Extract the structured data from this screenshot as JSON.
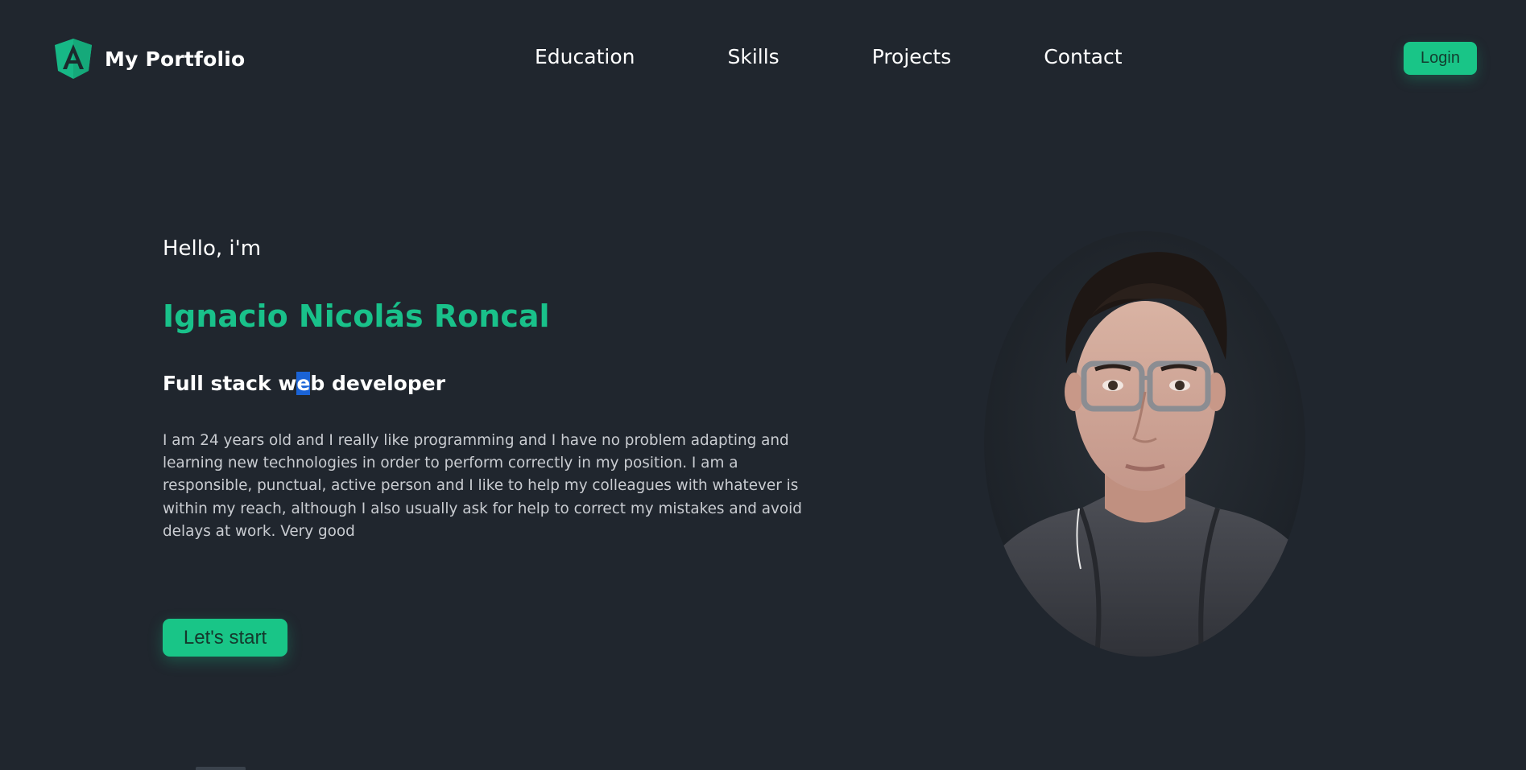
{
  "header": {
    "brand_title": "My Portfolio",
    "brand_icon": "angular-shield-icon",
    "nav": [
      {
        "label": "Education"
      },
      {
        "label": "Skills"
      },
      {
        "label": "Projects"
      },
      {
        "label": "Contact"
      }
    ],
    "login_label": "Login"
  },
  "hero": {
    "greeting": "Hello, i'm",
    "name": "Ignacio Nicolás Roncal",
    "role_before": "Full stack w",
    "role_selected": "e",
    "role_after": "b developer",
    "bio": "I am 24 years old and I really like programming and I have no problem adapting and learning new technologies in order to perform correctly in my position. I am a responsible, punctual, active person and I like to help my colleagues with whatever is within my reach, although I also usually ask for help to correct my mistakes and avoid delays at work. Very good",
    "cta_label": "Let's start"
  },
  "colors": {
    "background": "#20262e",
    "accent": "#19c587",
    "name_color": "#19c18a",
    "selection": "#1a63d6"
  }
}
